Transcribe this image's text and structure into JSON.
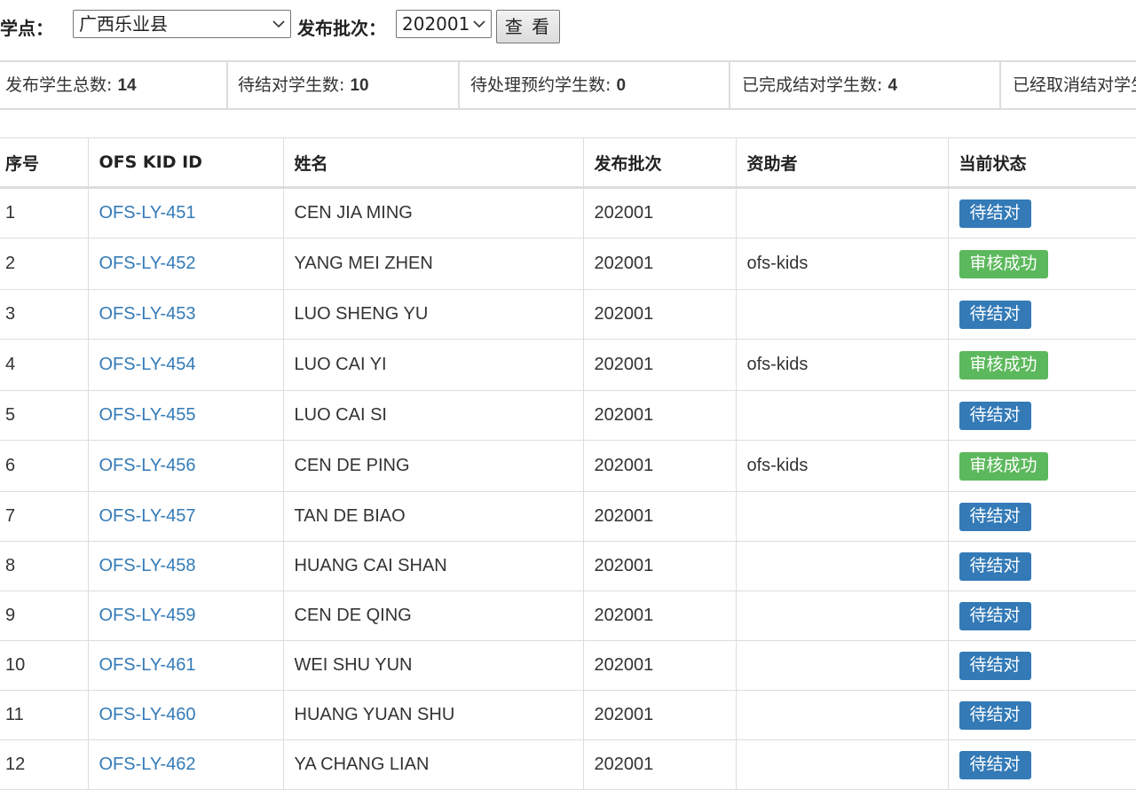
{
  "filters": {
    "site_label": "助学点：",
    "site_value": "广西乐业县",
    "batch_label": "发布批次：",
    "batch_value": "202001",
    "view_button": "查 看"
  },
  "stats": [
    {
      "label": "发布学生总数: ",
      "value": "14"
    },
    {
      "label": "待结对学生数: ",
      "value": "10"
    },
    {
      "label": "待处理预约学生数: ",
      "value": "0"
    },
    {
      "label": "已完成结对学生数: ",
      "value": "4"
    },
    {
      "label": "已经取消结对学生数: ",
      "value": ""
    }
  ],
  "table": {
    "headers": [
      "序号",
      "OFS KID ID",
      "姓名",
      "发布批次",
      "资助者",
      "当前状态"
    ],
    "rows": [
      {
        "no": "1",
        "kid_id": "OFS-LY-451",
        "name": "CEN JIA MING",
        "batch": "202001",
        "sponsor": "",
        "status": "待结对"
      },
      {
        "no": "2",
        "kid_id": "OFS-LY-452",
        "name": "YANG MEI ZHEN",
        "batch": "202001",
        "sponsor": "ofs-kids",
        "status": "审核成功"
      },
      {
        "no": "3",
        "kid_id": "OFS-LY-453",
        "name": "LUO SHENG YU",
        "batch": "202001",
        "sponsor": "",
        "status": "待结对"
      },
      {
        "no": "4",
        "kid_id": "OFS-LY-454",
        "name": "LUO CAI YI",
        "batch": "202001",
        "sponsor": "ofs-kids",
        "status": "审核成功"
      },
      {
        "no": "5",
        "kid_id": "OFS-LY-455",
        "name": "LUO CAI SI",
        "batch": "202001",
        "sponsor": "",
        "status": "待结对"
      },
      {
        "no": "6",
        "kid_id": "OFS-LY-456",
        "name": "CEN DE PING",
        "batch": "202001",
        "sponsor": "ofs-kids",
        "status": "审核成功"
      },
      {
        "no": "7",
        "kid_id": "OFS-LY-457",
        "name": "TAN DE BIAO",
        "batch": "202001",
        "sponsor": "",
        "status": "待结对"
      },
      {
        "no": "8",
        "kid_id": "OFS-LY-458",
        "name": "HUANG CAI SHAN",
        "batch": "202001",
        "sponsor": "",
        "status": "待结对"
      },
      {
        "no": "9",
        "kid_id": "OFS-LY-459",
        "name": "CEN DE QING",
        "batch": "202001",
        "sponsor": "",
        "status": "待结对"
      },
      {
        "no": "10",
        "kid_id": "OFS-LY-461",
        "name": "WEI SHU YUN",
        "batch": "202001",
        "sponsor": "",
        "status": "待结对"
      },
      {
        "no": "11",
        "kid_id": "OFS-LY-460",
        "name": "HUANG YUAN SHU",
        "batch": "202001",
        "sponsor": "",
        "status": "待结对"
      },
      {
        "no": "12",
        "kid_id": "OFS-LY-462",
        "name": "YA CHANG LIAN",
        "batch": "202001",
        "sponsor": "",
        "status": "待结对"
      }
    ]
  },
  "status_colors": {
    "待结对": "#337ab7",
    "审核成功": "#5cb85c"
  },
  "link_color": "#337ab7",
  "icons": {
    "select_arrow": "chevron-down-icon"
  }
}
